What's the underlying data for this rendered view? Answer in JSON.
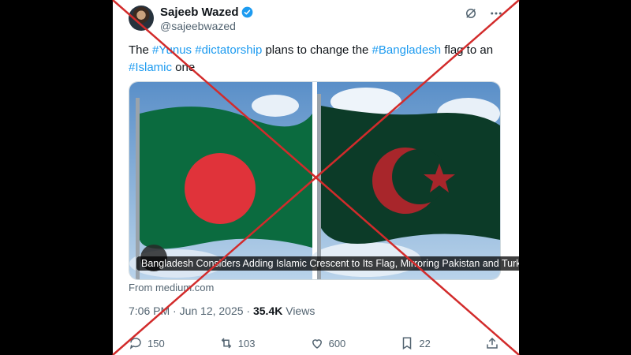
{
  "tweet": {
    "author_name": "Sajeeb Wazed",
    "author_handle": "@sajeebwazed",
    "text_parts": {
      "t1": "The ",
      "h1": "#Yunus",
      "t2": " ",
      "h2": "#dictatorship",
      "t3": " plans to change the ",
      "h3": "#Bangladesh",
      "t4": " flag to an",
      "h4": "#Islamic",
      "t5": " one"
    },
    "media_caption": "Bangladesh Considers Adding Islamic Crescent to Its Flag, Mirroring Pakistan and Turkey",
    "link_source": "From medium.com",
    "time": "7:06 PM · Jun 12, 2025 · ",
    "views_count": "35.4K",
    "views_label": " Views",
    "replies": "150",
    "retweets": "103",
    "likes": "600",
    "bookmarks": "22"
  },
  "icons": [
    "verified-badge-icon",
    "grok-icon",
    "more-icon",
    "camera-icon",
    "reply-icon",
    "retweet-icon",
    "like-icon",
    "bookmark-icon",
    "share-icon"
  ],
  "colors": {
    "accent": "#1d9bf0",
    "overlay_cross": "#d22b2b",
    "bd_green": "#006a4e",
    "bd_red": "#f42a41"
  }
}
